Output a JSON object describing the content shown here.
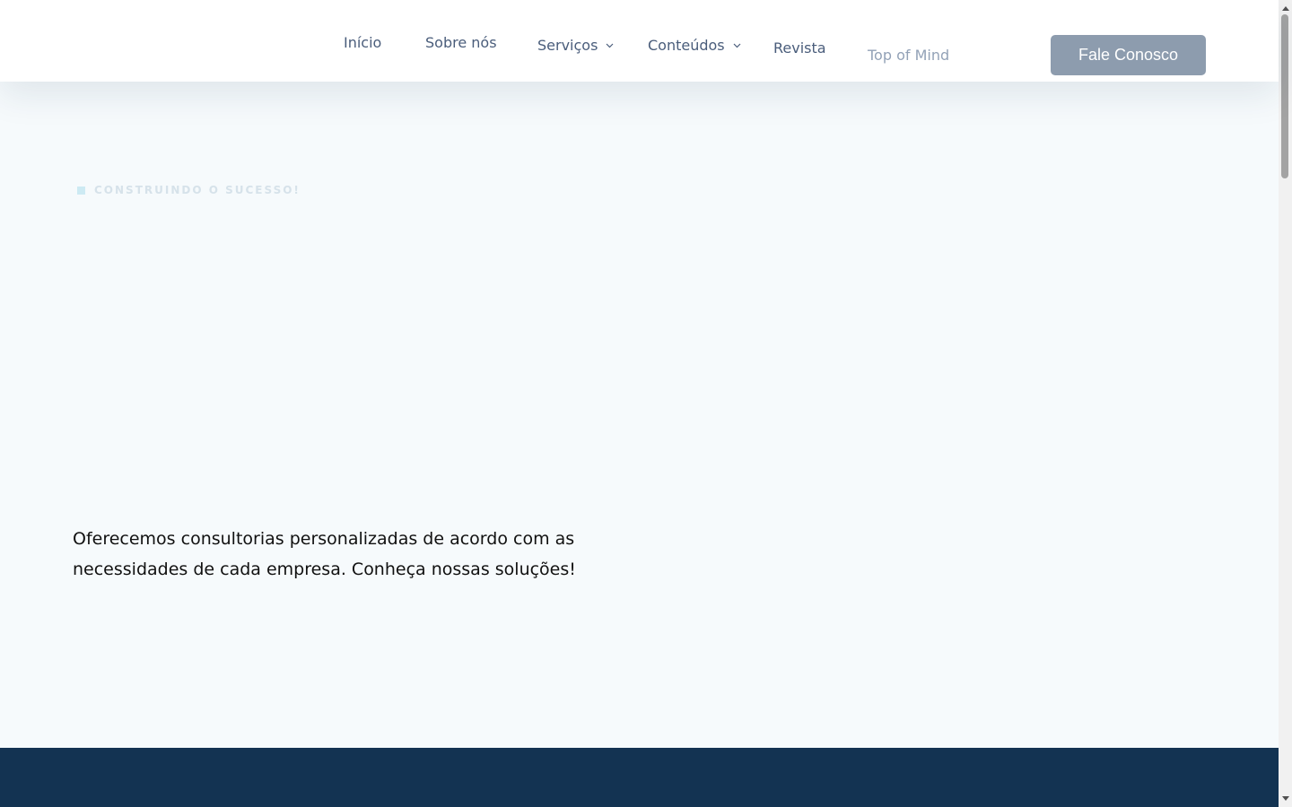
{
  "nav": {
    "items": [
      {
        "label": "Início"
      },
      {
        "label": "Sobre nós"
      },
      {
        "label": "Serviços",
        "dropdown": true
      },
      {
        "label": "Conteúdos",
        "dropdown": true
      },
      {
        "label": "Revista"
      },
      {
        "label": "Top of Mind"
      }
    ],
    "cta_label": "Fale Conosco"
  },
  "hero": {
    "eyebrow": "CONSTRUINDO O SUCESSO!",
    "description": "Oferecemos consultorias personalizadas de acordo com as necessidades de cada empresa. Conheça nossas soluções!"
  },
  "colors": {
    "nav_text": "#4a5d7b",
    "cta_bg": "#8d9cae",
    "hero_bg": "#f6fafc",
    "footer_band": "#133352"
  },
  "icons": {
    "dropdown": "chevron-down-icon",
    "scroll_up": "arrow-up-icon",
    "scroll_down": "arrow-down-icon"
  }
}
